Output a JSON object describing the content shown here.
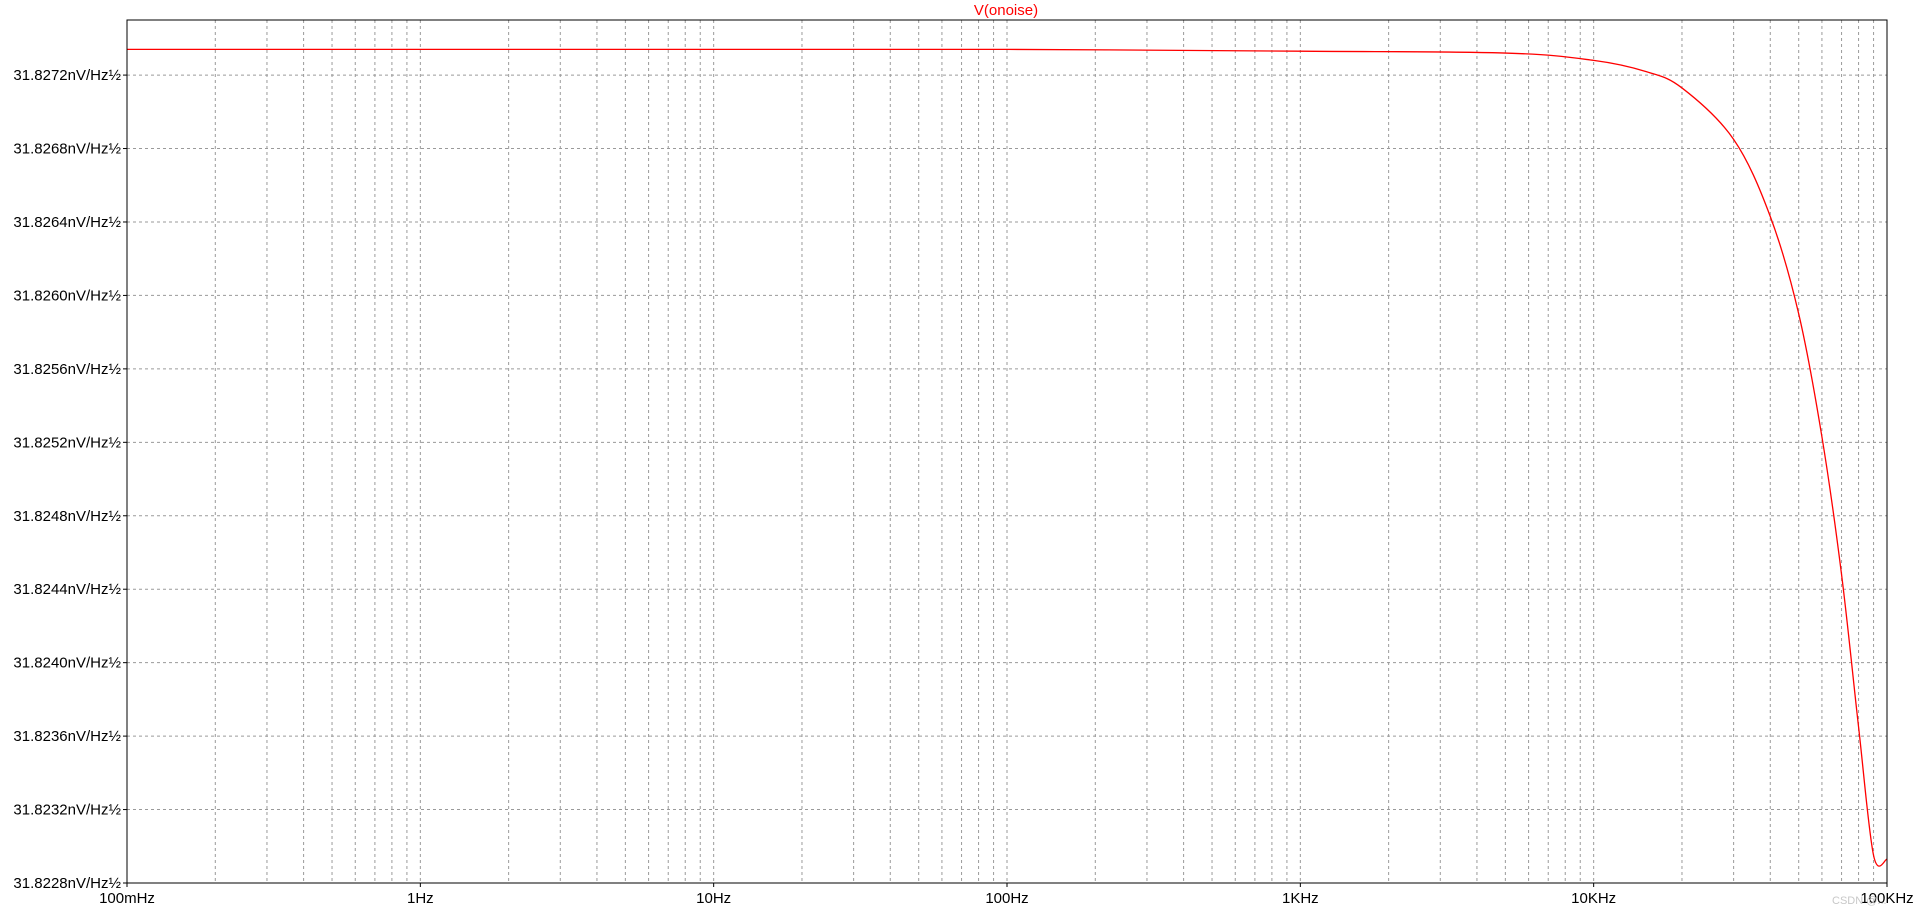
{
  "chart_data": {
    "type": "line",
    "title": "V(onoise)",
    "xlabel": "",
    "ylabel": "",
    "x_scale": "log",
    "xlim": [
      0.1,
      100000
    ],
    "ylim": [
      31.8228,
      31.8275
    ],
    "grid": true,
    "x_tick_labels": [
      "100mHz",
      "1Hz",
      "10Hz",
      "100Hz",
      "1KHz",
      "10KHz",
      "100KHz"
    ],
    "y_tick_labels": [
      "31.8272nV/Hz½",
      "31.8268nV/Hz½",
      "31.8264nV/Hz½",
      "31.8260nV/Hz½",
      "31.8256nV/Hz½",
      "31.8252nV/Hz½",
      "31.8248nV/Hz½",
      "31.8244nV/Hz½",
      "31.8240nV/Hz½",
      "31.8236nV/Hz½",
      "31.8232nV/Hz½",
      "31.8228nV/Hz½"
    ],
    "series": [
      {
        "color": "#ff0000",
        "x": [
          0.1,
          1,
          10,
          100,
          1000,
          5000,
          10000,
          15000,
          20000,
          30000,
          40000,
          50000,
          60000,
          70000,
          80000,
          90000,
          100000
        ],
        "y": [
          31.82734,
          31.82734,
          31.82734,
          31.82734,
          31.82733,
          31.82732,
          31.82728,
          31.82722,
          31.82713,
          31.82685,
          31.82643,
          31.8259,
          31.82523,
          31.82448,
          31.82365,
          31.82295,
          31.82293
        ]
      }
    ]
  },
  "watermark": "CSDN @..."
}
